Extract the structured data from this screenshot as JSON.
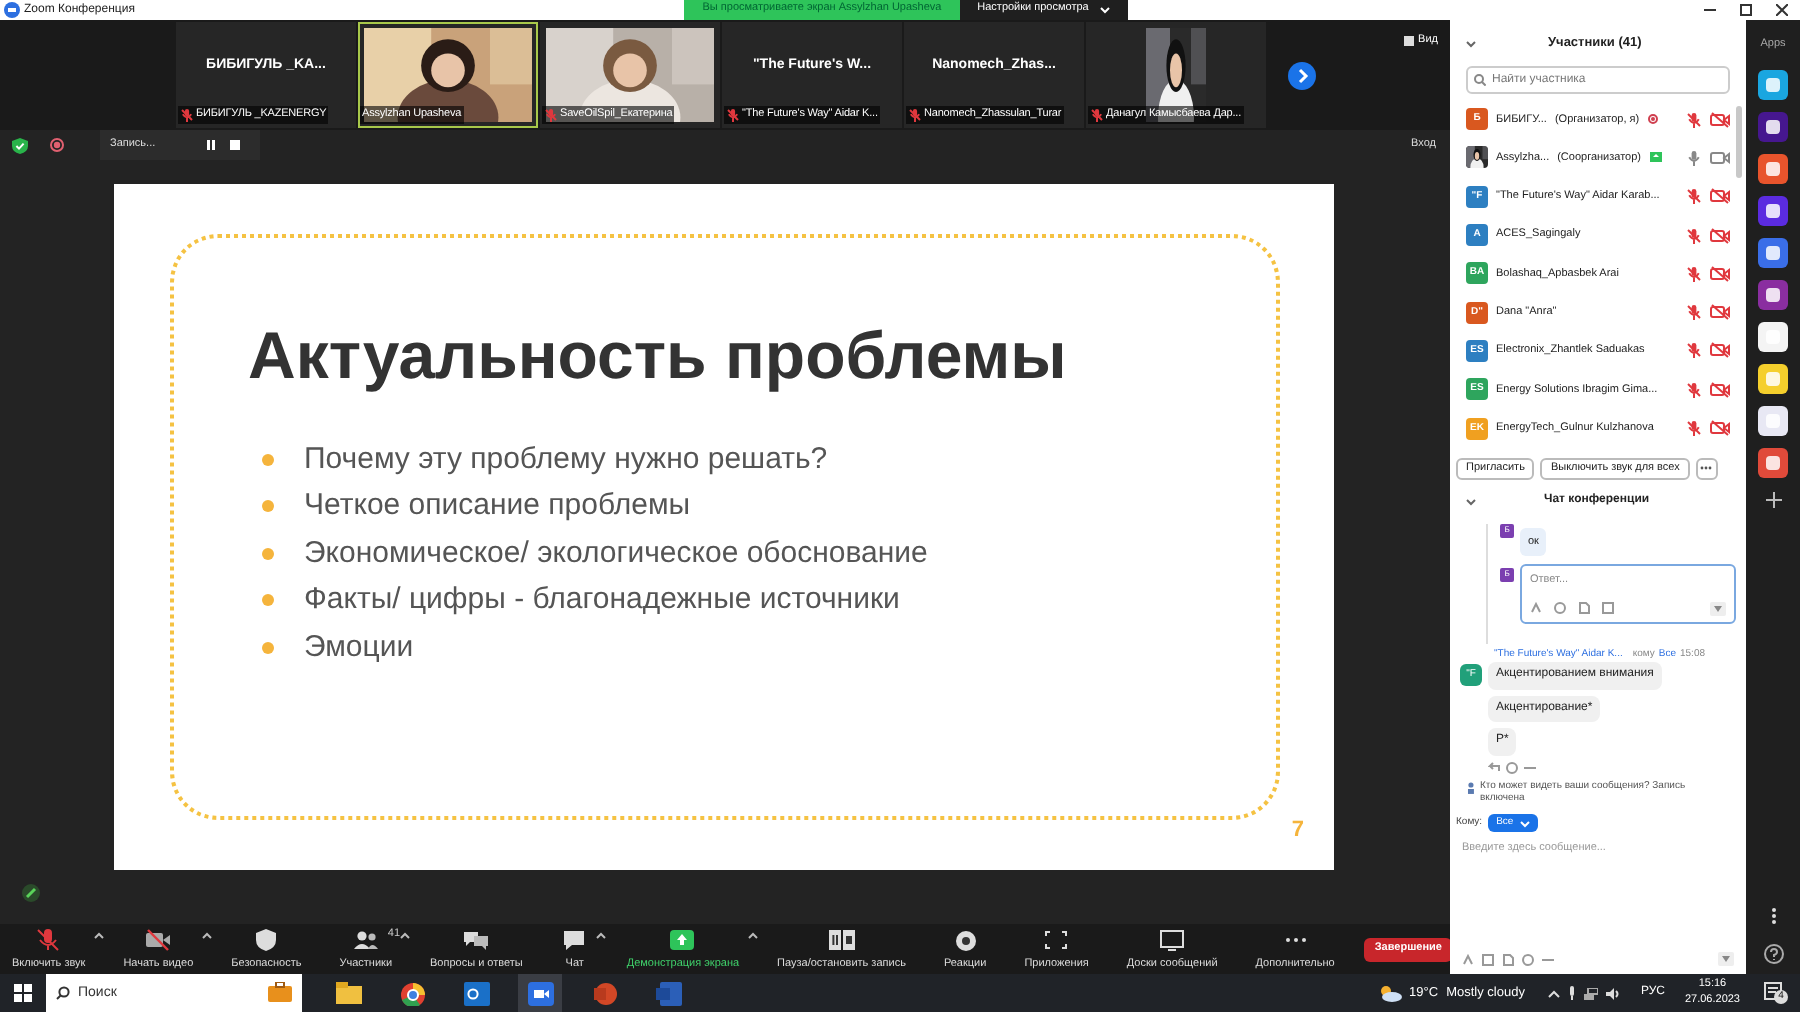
{
  "window": {
    "title": "Zoom Конференция"
  },
  "share_banner": {
    "text": "Вы просматриваете экран Assylzhan Upasheva",
    "view_options": "Настройки просмотра"
  },
  "video_strip": {
    "tiles": [
      {
        "kind": "name",
        "display": "БИБИГУЛЬ _KA...",
        "name": "БИБИГУЛЬ _KAZENERGY",
        "muted": true,
        "active_speaker": false
      },
      {
        "kind": "picture",
        "name": "Assylzhan Upasheva",
        "muted": false,
        "active_speaker": true
      },
      {
        "kind": "picture",
        "name": "SaveOilSpil_Екатерина",
        "muted": true,
        "active_speaker": false
      },
      {
        "kind": "name",
        "display": "\"The Future's W...",
        "name": "\"The Future's Way\" Aidar K...",
        "muted": true,
        "active_speaker": false
      },
      {
        "kind": "name",
        "display": "Nanomech_Zhas...",
        "name": "Nanomech_Zhassulan_Turar",
        "muted": true,
        "active_speaker": false
      },
      {
        "kind": "picture",
        "name": "Данагул Камысбаева Дар...",
        "muted": true,
        "active_speaker": false
      }
    ],
    "view": "Вид"
  },
  "recording": {
    "label": "Запись..."
  },
  "enter_label": "Вход",
  "slide": {
    "title": "Актуальность проблемы",
    "bullets": [
      "Почему эту проблему нужно решать?",
      "Четкое описание проблемы",
      "Экономическое/ экологическое обоснование",
      "Факты/ цифры - благонадежные источники",
      "Эмоции"
    ],
    "page": "7"
  },
  "toolbar": {
    "items": [
      {
        "kind": "mic",
        "label": "Включить звук",
        "off": true
      },
      {
        "kind": "video",
        "label": "Начать видео",
        "off": true
      },
      {
        "kind": "security",
        "label": "Безопасность",
        "off": false
      },
      {
        "kind": "participants",
        "label": "Участники",
        "badge": "41",
        "off": false
      },
      {
        "kind": "qa",
        "label": "Вопросы и ответы",
        "off": false
      },
      {
        "kind": "chat",
        "label": "Чат",
        "off": false
      },
      {
        "kind": "share",
        "label": "Демонстрация экрана",
        "off": false
      },
      {
        "kind": "record",
        "label": "Пауза/остановить запись",
        "off": false
      },
      {
        "kind": "reactions",
        "label": "Реакции",
        "off": false
      },
      {
        "kind": "apps",
        "label": "Приложения",
        "off": false
      },
      {
        "kind": "board",
        "label": "Доски сообщений",
        "off": false
      },
      {
        "kind": "more",
        "label": "Дополнительно",
        "off": false
      }
    ],
    "end": "Завершение"
  },
  "participants": {
    "title": "Участники (41)",
    "search_placeholder": "Найти участника",
    "rows": [
      {
        "kind": "initials",
        "initials": "Б",
        "color": "#d9581f",
        "name": "БИБИГУ...",
        "role": "(Организатор, я)",
        "recording": true,
        "sharing": false,
        "mic_muted": true,
        "video_muted": true
      },
      {
        "kind": "picture",
        "name": "Assylzha...",
        "role": "(Соорганизатор)",
        "recording": false,
        "sharing": true,
        "mic_muted": false,
        "video_muted": false
      },
      {
        "kind": "initials",
        "initials": "\"F",
        "color": "#2d7fc1",
        "name": "\"The Future's Way\" Aidar Karab...",
        "recording": false,
        "sharing": false,
        "mic_muted": true,
        "video_muted": true
      },
      {
        "kind": "initials",
        "initials": "A",
        "color": "#2d7fc1",
        "name": "ACES_Sagingaly",
        "recording": false,
        "sharing": false,
        "mic_muted": true,
        "video_muted": true
      },
      {
        "kind": "initials",
        "initials": "BA",
        "color": "#2ea55d",
        "name": "Bolashaq_Apbasbek Arai",
        "recording": false,
        "sharing": false,
        "mic_muted": true,
        "video_muted": true
      },
      {
        "kind": "initials",
        "initials": "D\"",
        "color": "#d9581f",
        "name": "Dana \"Anra\"",
        "recording": false,
        "sharing": false,
        "mic_muted": true,
        "video_muted": true
      },
      {
        "kind": "initials",
        "initials": "ES",
        "color": "#2d7fc1",
        "name": "Electronix_Zhantlek Saduakas",
        "recording": false,
        "sharing": false,
        "mic_muted": true,
        "video_muted": true
      },
      {
        "kind": "initials",
        "initials": "ES",
        "color": "#2ea55d",
        "name": "Energy Solutions Ibragim Gima...",
        "recording": false,
        "sharing": false,
        "mic_muted": true,
        "video_muted": true
      },
      {
        "kind": "initials",
        "initials": "EK",
        "color": "#f0a020",
        "name": "EnergyTech_Gulnur Kulzhanova",
        "recording": false,
        "sharing": false,
        "mic_muted": true,
        "video_muted": true
      }
    ],
    "invite": "Пригласить",
    "mute_all": "Выключить звук для всех"
  },
  "chat": {
    "title": "Чат конференции",
    "thread": {
      "message_avatar": "Б",
      "message": "ок",
      "reply_avatar": "Б",
      "reply_placeholder": "Ответ..."
    },
    "message": {
      "avatar": "\"F",
      "sender": "\"The Future's Way\" Aidar K...",
      "to_label": "кому",
      "to": "Все",
      "time": "15:08",
      "bubbles": [
        "Акцентированием внимания",
        "Акцентирование*",
        "Р*"
      ]
    },
    "notice": "Кто может видеть ваши сообщения? Запись включена",
    "recipient_label": "Кому:",
    "recipient": "Все",
    "input_placeholder": "Введите здесь сообщение..."
  },
  "apps_bar": {
    "title": "Apps",
    "apps": [
      {
        "color": "#1aa6e0"
      },
      {
        "color": "#46178f"
      },
      {
        "color": "#e8542c"
      },
      {
        "color": "#5b2be0"
      },
      {
        "color": "#3a6ee8"
      },
      {
        "color": "#8a2ea0"
      },
      {
        "color": "#f4f4f4"
      },
      {
        "color": "#f5cf2c"
      },
      {
        "color": "#e8e8f4"
      },
      {
        "color": "#e04a3a"
      }
    ]
  },
  "taskbar": {
    "search_placeholder": "Поиск",
    "temperature": "19°C",
    "weather": "Mostly cloudy",
    "language": "РУС",
    "time": "15:16",
    "date": "27.06.2023",
    "notifications": "4"
  }
}
